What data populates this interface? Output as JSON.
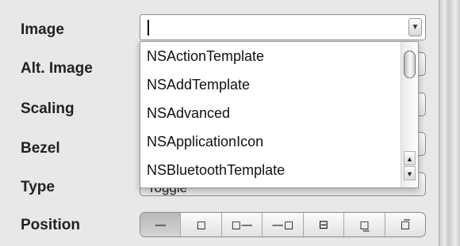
{
  "labels": {
    "image": "Image",
    "alt_image": "Alt. Image",
    "scaling": "Scaling",
    "bezel": "Bezel",
    "type": "Type",
    "position": "Position"
  },
  "image_field": {
    "value": ""
  },
  "type_field": {
    "value": "Toggle"
  },
  "dropdown": {
    "items": [
      "NSActionTemplate",
      "NSAddTemplate",
      "NSAdvanced",
      "NSApplicationIcon",
      "NSBluetoothTemplate"
    ],
    "scroll_up_glyph": "▲",
    "scroll_down_glyph": "▼",
    "scroll_fraction": 0.0
  },
  "combo_arrow_glyph": "▼",
  "position_segments": [
    {
      "icon": "text-only-icon",
      "glyph": "—"
    },
    {
      "icon": "image-only-icon",
      "glyph": "◻"
    },
    {
      "icon": "image-left-icon",
      "glyph": "◻—"
    },
    {
      "icon": "image-right-icon",
      "glyph": "—◻"
    },
    {
      "icon": "image-overlaps-icon",
      "glyph": "⊟"
    },
    {
      "icon": "image-above-icon",
      "glyph": "◻̲"
    },
    {
      "icon": "image-below-icon",
      "glyph": "◻̅"
    }
  ],
  "position_selected_index": 0
}
